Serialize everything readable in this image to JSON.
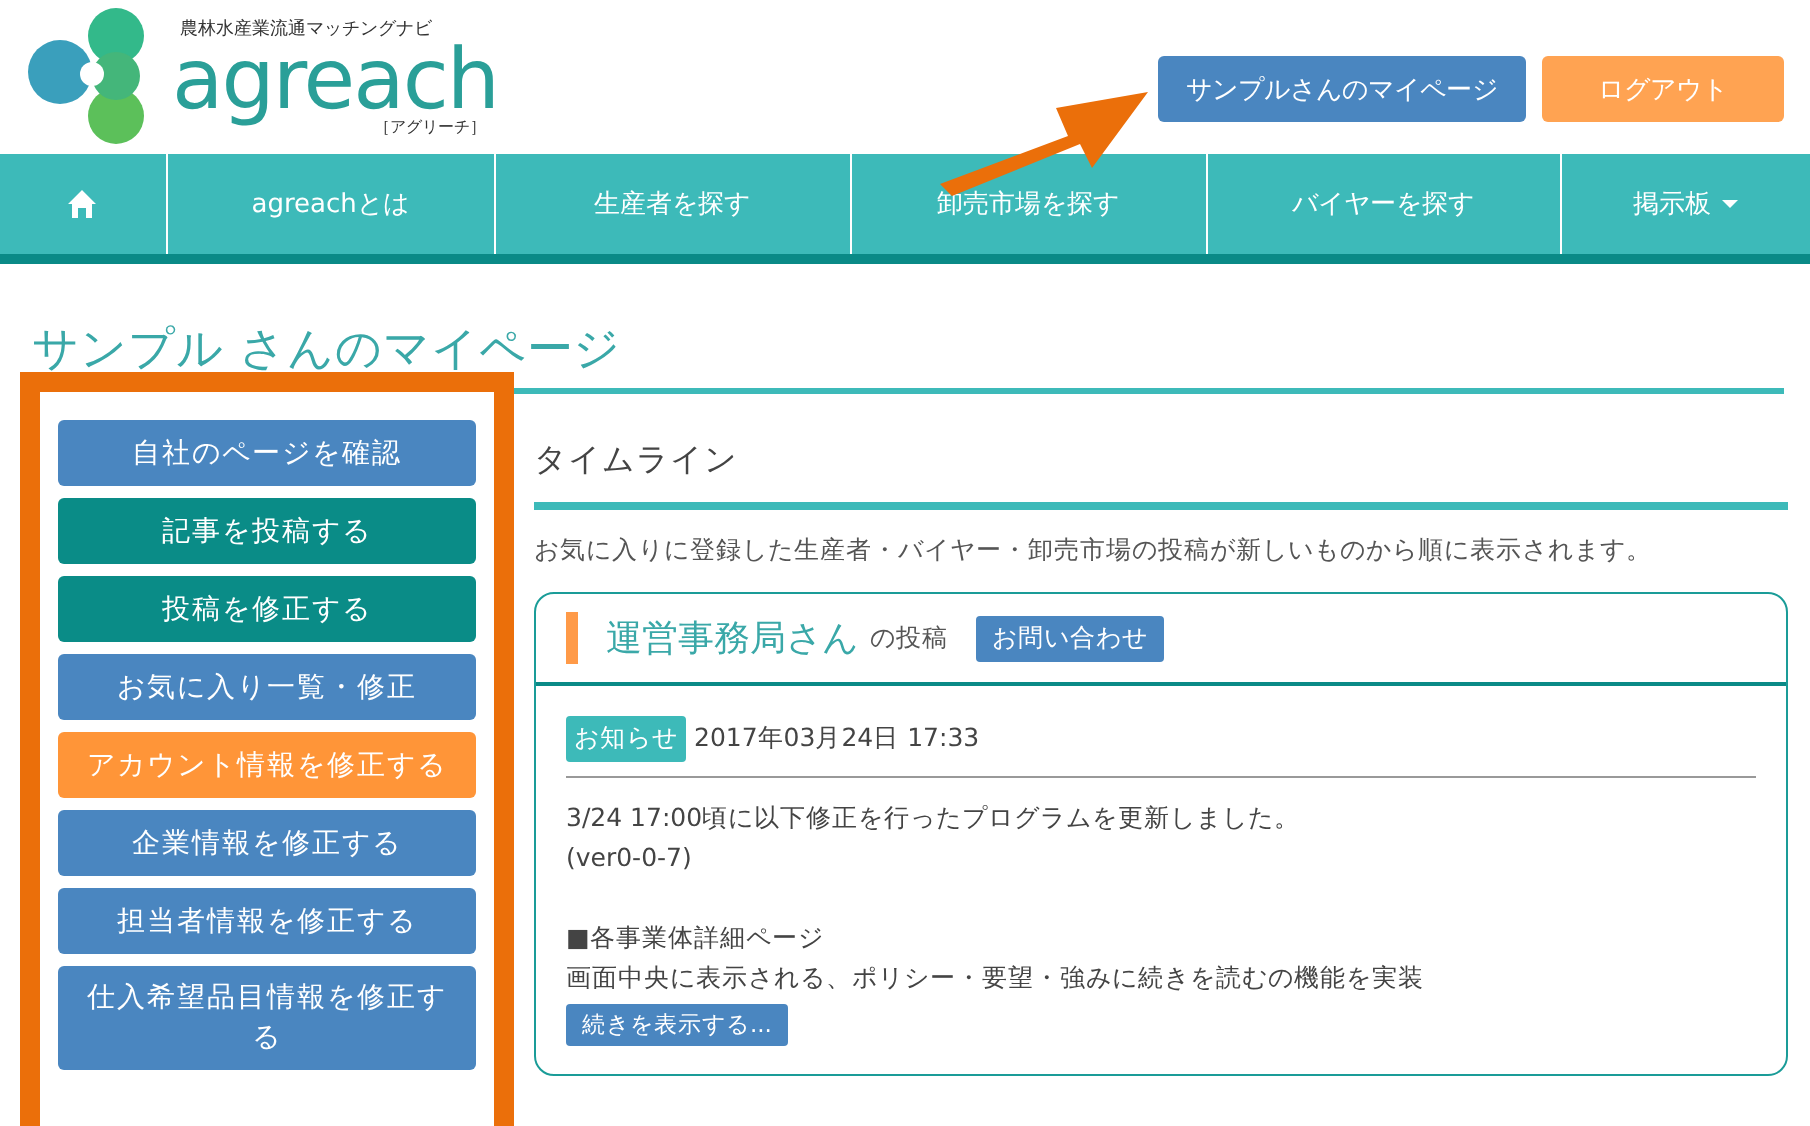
{
  "logo": {
    "tagline": "農林水産業流通マッチングナビ",
    "name": "agreach",
    "reading": "［アグリーチ］"
  },
  "header_buttons": [
    {
      "label": "サンプルさんのマイページ",
      "kind": "primary"
    },
    {
      "label": "ログアウト",
      "kind": "warning"
    }
  ],
  "nav": [
    {
      "kind": "home"
    },
    {
      "label": "agreachとは",
      "kind": "link"
    },
    {
      "label": "生産者を探す",
      "kind": "link"
    },
    {
      "label": "卸売市場を探す",
      "kind": "link"
    },
    {
      "label": "バイヤーを探す",
      "kind": "link"
    },
    {
      "label": "掲示板",
      "kind": "dropdown"
    }
  ],
  "page_title": "サンプル さんのマイページ",
  "sidebar": {
    "items": [
      {
        "label": "自社のページを確認",
        "kind": "primary"
      },
      {
        "label": "記事を投稿する",
        "kind": "post"
      },
      {
        "label": "投稿を修正する",
        "kind": "post"
      },
      {
        "label": "お気に入り一覧・修正",
        "kind": "primary"
      },
      {
        "label": "アカウント情報を修正する",
        "kind": "current"
      },
      {
        "label": "企業情報を修正する",
        "kind": "primary"
      },
      {
        "label": "担当者情報を修正する",
        "kind": "primary"
      },
      {
        "label": "仕入希望品目情報を修正する",
        "kind": "primary"
      }
    ]
  },
  "timeline": {
    "heading": "タイムライン",
    "description": "お気に入りに登録した生産者・バイヤー・卸売市場の投稿が新しいものから順に表示されます。",
    "posts": [
      {
        "author": "運営事務局さん",
        "suffix": "の投稿",
        "contact_button": "お問い合わせ",
        "tag": "お知らせ",
        "date": "2017年03月24日 17:33",
        "paragraphs": [
          [
            "3/24 17:00頃に以下修正を行ったプログラムを更新しました。",
            "(ver0-0-7)"
          ],
          [
            "■各事業体詳細ページ",
            "画面中央に表示される、ポリシー・要望・強みに続きを読むの機能を実装"
          ]
        ],
        "more_button": "続きを表示する..."
      }
    ]
  }
}
